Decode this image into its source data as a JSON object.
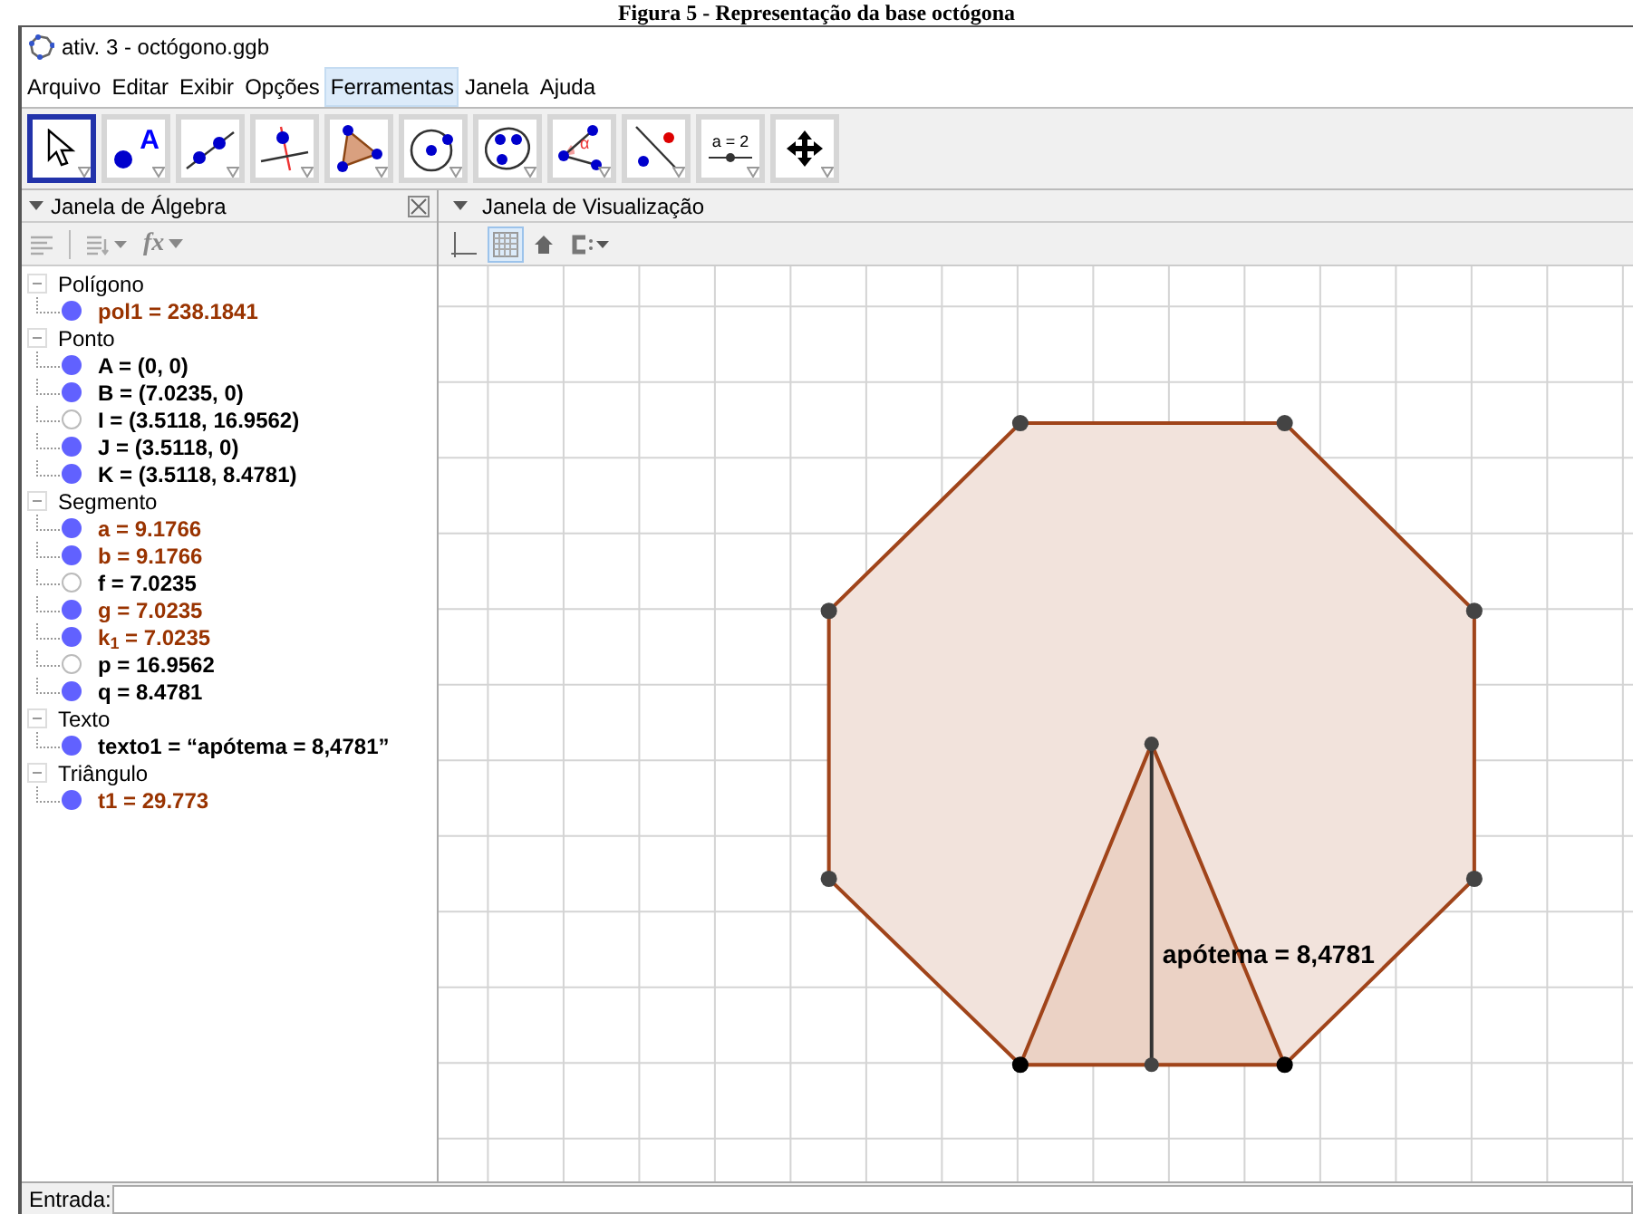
{
  "caption": "Figura 5 - Representação da base octógona",
  "window": {
    "title": "ativ. 3 - octógono.ggb"
  },
  "menu": [
    {
      "label": "Arquivo",
      "selected": false
    },
    {
      "label": "Editar",
      "selected": false
    },
    {
      "label": "Exibir",
      "selected": false
    },
    {
      "label": "Opções",
      "selected": false
    },
    {
      "label": "Ferramentas",
      "selected": true
    },
    {
      "label": "Janela",
      "selected": false
    },
    {
      "label": "Ajuda",
      "selected": false
    }
  ],
  "tools": [
    {
      "kind": "move",
      "selected": true
    },
    {
      "kind": "point",
      "label": "A",
      "selected": false
    },
    {
      "kind": "line",
      "selected": false
    },
    {
      "kind": "perpendicular",
      "selected": false
    },
    {
      "kind": "polygon",
      "selected": false
    },
    {
      "kind": "circle",
      "selected": false
    },
    {
      "kind": "ellipse",
      "selected": false
    },
    {
      "kind": "angle",
      "label": "α",
      "selected": false
    },
    {
      "kind": "reflect",
      "selected": false
    },
    {
      "kind": "slider",
      "label": "a = 2",
      "selected": false
    },
    {
      "kind": "pan",
      "selected": false
    }
  ],
  "algebra": {
    "title": "Janela de Álgebra",
    "fx": "fx",
    "groups": [
      {
        "label": "Polígono",
        "expanded": true,
        "children": [
          {
            "text": "pol1 = 238.1841",
            "color": "#993300",
            "visible": true
          }
        ]
      },
      {
        "label": "Ponto",
        "expanded": true,
        "children": [
          {
            "text": "A = (0, 0)",
            "color": "#000000",
            "visible": true
          },
          {
            "text": "B = (7.0235, 0)",
            "color": "#000000",
            "visible": true
          },
          {
            "text": "I = (3.5118, 16.9562)",
            "color": "#000000",
            "visible": false
          },
          {
            "text": "J = (3.5118, 0)",
            "color": "#000000",
            "visible": true
          },
          {
            "text": "K = (3.5118, 8.4781)",
            "color": "#000000",
            "visible": true
          }
        ]
      },
      {
        "label": "Segmento",
        "expanded": true,
        "children": [
          {
            "text": "a = 9.1766",
            "color": "#993300",
            "visible": true
          },
          {
            "text": "b = 9.1766",
            "color": "#993300",
            "visible": true
          },
          {
            "text": "f = 7.0235",
            "color": "#000000",
            "visible": false
          },
          {
            "text": "g = 7.0235",
            "color": "#993300",
            "visible": true
          },
          {
            "text": "k$_{1}$ = 7.0235",
            "color": "#993300",
            "visible": true
          },
          {
            "text": "p = 16.9562",
            "color": "#000000",
            "visible": false
          },
          {
            "text": "q = 8.4781",
            "color": "#000000",
            "visible": true
          }
        ]
      },
      {
        "label": "Texto",
        "expanded": true,
        "children": [
          {
            "text": "texto1 = “apótema = 8,4781”",
            "color": "#000000",
            "visible": true
          }
        ]
      },
      {
        "label": "Triângulo",
        "expanded": true,
        "children": [
          {
            "text": "t1 = 29.773",
            "color": "#993300",
            "visible": true
          }
        ]
      }
    ]
  },
  "graphics": {
    "title": "Janela de Visualização",
    "toolbar": [
      {
        "kind": "axes",
        "selected": false
      },
      {
        "kind": "grid",
        "selected": true
      },
      {
        "kind": "home",
        "selected": false
      },
      {
        "kind": "style",
        "selected": false
      }
    ],
    "label": "apótema = 8,4781"
  },
  "input": {
    "label": "Entrada:"
  }
}
